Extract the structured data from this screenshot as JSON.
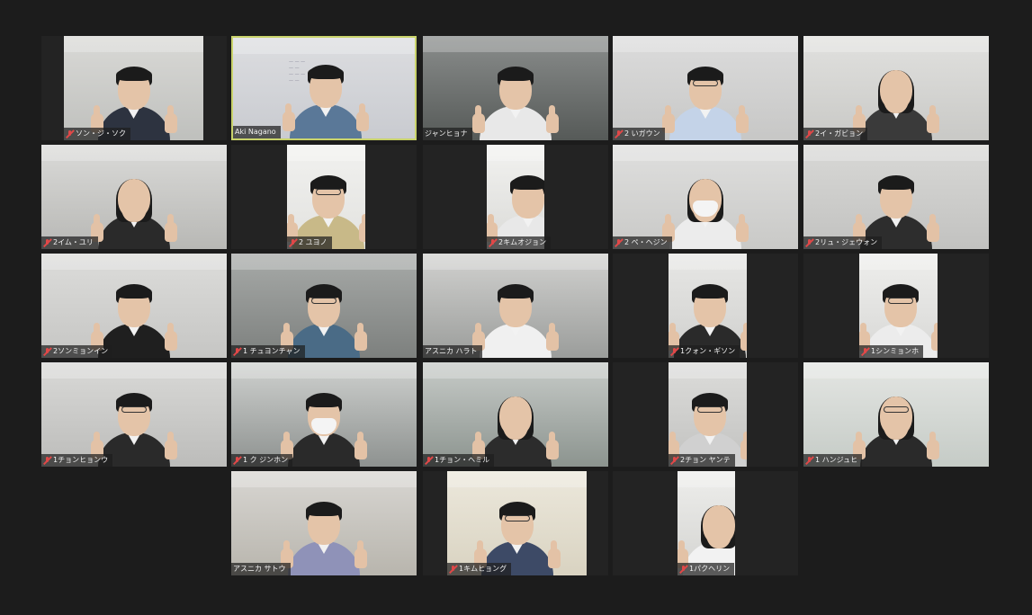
{
  "colors": {
    "background": "#1c1c1c",
    "tile_background": "#232323",
    "active_speaker_border": "#c9d36b",
    "name_tag_bg": "rgba(30,30,30,0.72)",
    "muted_icon": "#e04848"
  },
  "participants": [
    {
      "name": "ソン・ジ・ソク",
      "muted": true
    },
    {
      "name": "Aki Nagano",
      "muted": false,
      "active_speaker": true
    },
    {
      "name": "ジャンヒョナ",
      "muted": false
    },
    {
      "name": "2 いガウン",
      "muted": true
    },
    {
      "name": "2イ・ガビョン",
      "muted": true
    },
    {
      "name": "2イム・ユリ",
      "muted": true
    },
    {
      "name": "2 ユヨノ",
      "muted": true
    },
    {
      "name": "2キムオジョン",
      "muted": true
    },
    {
      "name": "2 ペ・ヘジン",
      "muted": true
    },
    {
      "name": "2リュ・ジェウォン",
      "muted": true
    },
    {
      "name": "2ソンミョンイン",
      "muted": true
    },
    {
      "name": "1 チュヨンチャン",
      "muted": true
    },
    {
      "name": "アスニカ ハラト",
      "muted": false
    },
    {
      "name": "1クォン・ギソン",
      "muted": true
    },
    {
      "name": "1シンミョンホ",
      "muted": true
    },
    {
      "name": "1チョンヒョンウ",
      "muted": true
    },
    {
      "name": "1 ク ジンホン",
      "muted": true
    },
    {
      "name": "1チョン・ヘミル",
      "muted": true
    },
    {
      "name": "2チョン ヤンテ",
      "muted": true
    },
    {
      "name": "1 ハンジュヒ",
      "muted": true
    },
    {
      "name": "アスニカ サトウ",
      "muted": false
    },
    {
      "name": "1キムヒョング",
      "muted": true
    },
    {
      "name": "1パクヘリン",
      "muted": true
    }
  ]
}
